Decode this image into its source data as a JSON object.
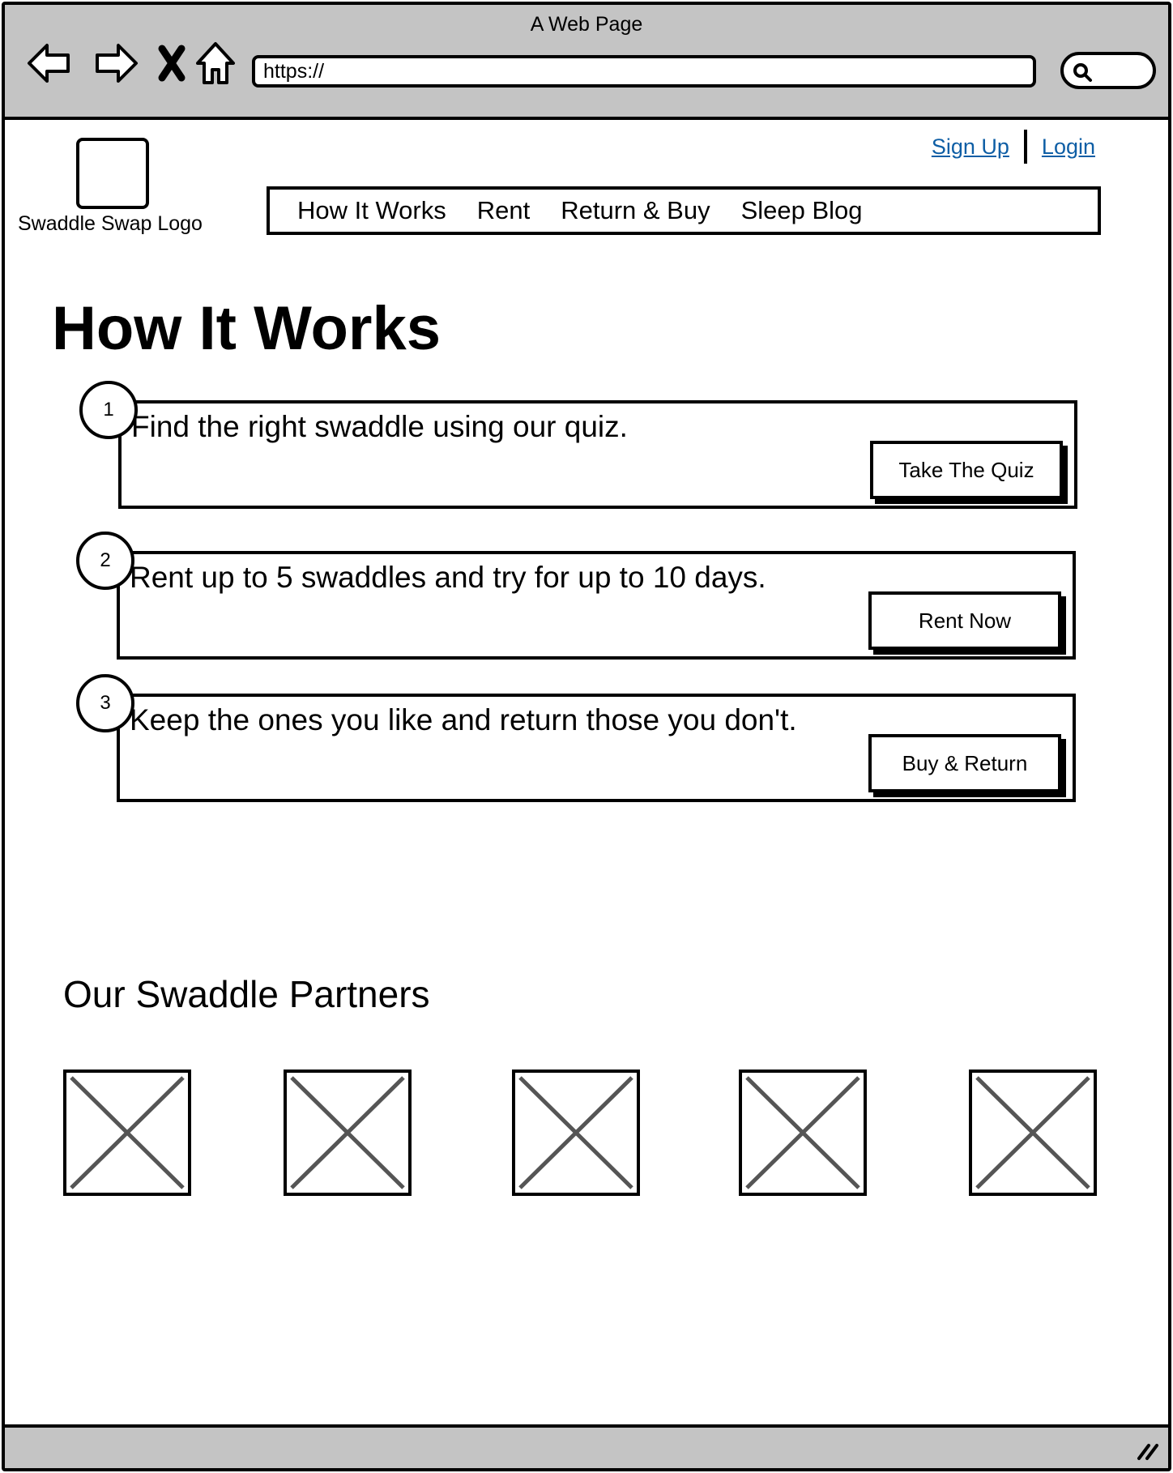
{
  "browser": {
    "window_title": "A Web Page",
    "url": "https://",
    "icons": [
      "back-icon",
      "forward-icon",
      "stop-icon",
      "home-icon",
      "search-icon"
    ]
  },
  "header": {
    "logo_label": "Swaddle Swap Logo",
    "sign_up": "Sign Up",
    "login": "Login",
    "link_color": "#0e5ea5"
  },
  "nav": {
    "items": [
      "How It Works",
      "Rent",
      "Return & Buy",
      "Sleep Blog"
    ]
  },
  "main": {
    "title": "How It Works",
    "steps": [
      {
        "number": "1",
        "text": "Find the right swaddle using our quiz.",
        "button": "Take The Quiz"
      },
      {
        "number": "2",
        "text": "Rent up to 5 swaddles and try for up to 10 days.",
        "button": "Rent Now"
      },
      {
        "number": "3",
        "text": "Keep the ones you like and return those you don't.",
        "button": "Buy & Return"
      }
    ]
  },
  "partners": {
    "title": "Our Swaddle Partners",
    "logo_count": 5
  },
  "colors": {
    "chrome": "#c4c4c4",
    "placeholder_x": "#555555"
  }
}
